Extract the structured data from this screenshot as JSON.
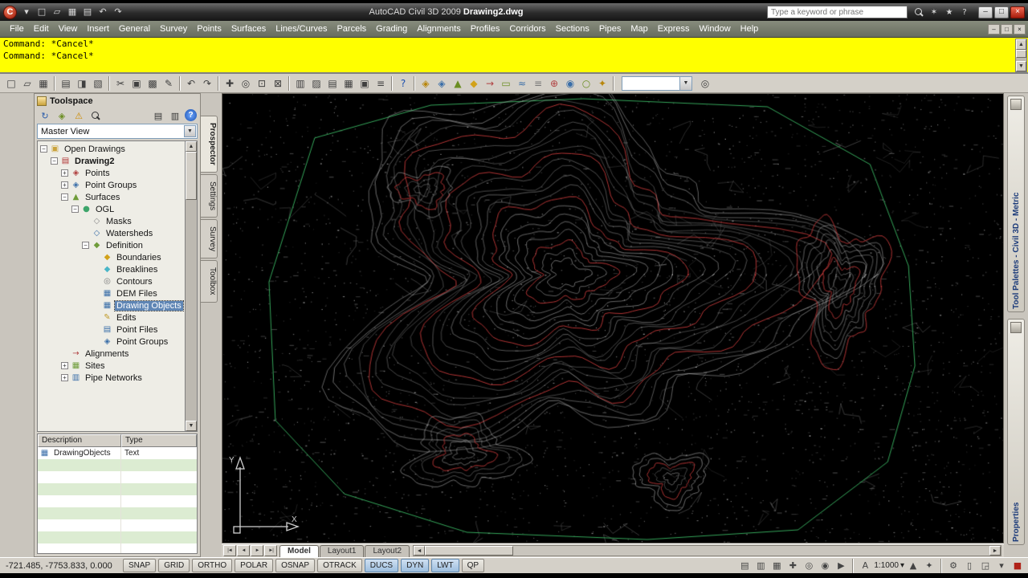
{
  "window": {
    "app_title": "AutoCAD Civil 3D 2009",
    "doc_title": "Drawing2.dwg",
    "search_placeholder": "Type a keyword or phrase",
    "controls": {
      "minimize": "–",
      "maximize": "□",
      "close": "×"
    },
    "doc_controls": [
      "–",
      "□",
      "×"
    ]
  },
  "titlebar": {
    "icons": [
      {
        "n": "menu-browser",
        "g": "▾"
      },
      {
        "n": "qnew",
        "g": "□"
      },
      {
        "n": "open",
        "g": "▱"
      },
      {
        "n": "save",
        "g": "▦"
      },
      {
        "n": "plot",
        "g": "▤"
      },
      {
        "n": "undo",
        "g": "↶"
      },
      {
        "n": "redo",
        "g": "↷"
      }
    ],
    "infocenter_icons": [
      {
        "n": "search-go",
        "mag": true
      },
      {
        "n": "communication-center",
        "g": "✶"
      },
      {
        "n": "favorites-star",
        "g": "★"
      },
      {
        "n": "infocenter-help",
        "g": "?"
      }
    ]
  },
  "menus": [
    "File",
    "Edit",
    "View",
    "Insert",
    "General",
    "Survey",
    "Points",
    "Surfaces",
    "Lines/Curves",
    "Parcels",
    "Grading",
    "Alignments",
    "Profiles",
    "Corridors",
    "Sections",
    "Pipes",
    "Map",
    "Express",
    "Window",
    "Help"
  ],
  "command": {
    "lines": [
      "Command: *Cancel*",
      "Command: *Cancel*"
    ]
  },
  "toolbar": {
    "items": [
      {
        "n": "qnew",
        "g": "□"
      },
      {
        "n": "open",
        "g": "▱"
      },
      {
        "n": "save",
        "g": "▦"
      },
      "|",
      {
        "n": "plot",
        "g": "▤"
      },
      {
        "n": "plot-preview",
        "g": "◨"
      },
      {
        "n": "publish",
        "g": "▧"
      },
      "|",
      {
        "n": "cut",
        "g": "✂"
      },
      {
        "n": "copy",
        "g": "▣"
      },
      {
        "n": "paste",
        "g": "▩"
      },
      {
        "n": "match-properties",
        "g": "✎"
      },
      "|",
      {
        "n": "undo",
        "g": "↶"
      },
      {
        "n": "redo",
        "g": "↷"
      },
      "|",
      {
        "n": "pan",
        "g": "✚"
      },
      {
        "n": "zoom-realtime",
        "g": "◎"
      },
      {
        "n": "zoom-window",
        "g": "⊡"
      },
      {
        "n": "zoom-previous",
        "g": "⊠"
      },
      "|",
      {
        "n": "properties-window",
        "g": "▥"
      },
      {
        "n": "designcenter",
        "g": "▨"
      },
      {
        "n": "tool-palettes-window",
        "g": "▤"
      },
      {
        "n": "sheet-set-manager",
        "g": "▦"
      },
      {
        "n": "markup-set-manager",
        "g": "▣"
      },
      {
        "n": "quickcalc",
        "g": "≡"
      },
      "|",
      {
        "n": "help",
        "g": "?",
        "c": "#1a4fae"
      },
      "|",
      {
        "n": "import-points",
        "g": "◈",
        "c": "#b8860b"
      },
      {
        "n": "point-groups-tool",
        "g": "◈",
        "c": "#3a6ea8"
      },
      {
        "n": "create-surface",
        "g": "▲",
        "c": "#6b8e23"
      },
      {
        "n": "surface-boundary",
        "g": "◆",
        "c": "#d2a21a"
      },
      {
        "n": "create-alignment",
        "g": "→",
        "c": "#b04040"
      },
      {
        "n": "create-parcel",
        "g": "▭",
        "c": "#6b8e23"
      },
      {
        "n": "create-profile",
        "g": "≈",
        "c": "#3a6ea8"
      },
      {
        "n": "create-corridor",
        "g": "≡",
        "c": "#777777"
      },
      {
        "n": "create-pipe-network",
        "g": "⊕",
        "c": "#b04040"
      },
      {
        "n": "create-grading",
        "g": "◉",
        "c": "#3a6ea8"
      },
      {
        "n": "create-site",
        "g": "○",
        "c": "#6b8e23"
      },
      {
        "n": "labels-menu",
        "g": "✦",
        "c": "#b8860b"
      },
      "|",
      {
        "combo": true
      },
      {
        "n": "named-views",
        "g": "◎"
      }
    ]
  },
  "toolspace": {
    "title": "Toolspace",
    "view_selector": "Master View",
    "tools_left": [
      {
        "n": "refresh",
        "g": "↻",
        "c": "#2a5caa"
      },
      {
        "n": "item-view",
        "g": "◈",
        "c": "#6b8e23"
      },
      {
        "n": "event-viewer",
        "g": "⚠",
        "c": "#cc8a00"
      },
      {
        "n": "search",
        "mag": true
      }
    ],
    "tools_right": [
      {
        "n": "preview-pane",
        "g": "▤"
      },
      {
        "n": "panorama",
        "g": "▥"
      },
      {
        "n": "toolspace-help",
        "help": true
      }
    ],
    "tabs": [
      {
        "label": "Prospector",
        "active": true
      },
      {
        "label": "Settings"
      },
      {
        "label": "Survey"
      },
      {
        "label": "Toolbox"
      }
    ],
    "tree": [
      {
        "label": "Open Drawings",
        "level": 0,
        "exp": "−",
        "glyph": "▣",
        "color": "#caa23a",
        "name": "open-drawings"
      },
      {
        "label": "Drawing2",
        "level": 1,
        "exp": "−",
        "glyph": "▤",
        "color": "#b03434",
        "bold": true,
        "name": "drawing2"
      },
      {
        "label": "Points",
        "level": 2,
        "exp": "+",
        "glyph": "◈",
        "color": "#b04040",
        "name": "points"
      },
      {
        "label": "Point Groups",
        "level": 2,
        "exp": "+",
        "glyph": "◈",
        "color": "#3a6ea8",
        "name": "point-groups"
      },
      {
        "label": "Surfaces",
        "level": 2,
        "exp": "−",
        "glyph": "▲",
        "color": "#6f9c3a",
        "name": "surfaces"
      },
      {
        "label": "OGL",
        "level": 3,
        "exp": "−",
        "glyph": "●",
        "color": "#3da56a",
        "name": "surface-ogl"
      },
      {
        "label": "Masks",
        "level": 4,
        "exp": "",
        "glyph": "◇",
        "color": "#8a8a8a",
        "name": "masks"
      },
      {
        "label": "Watersheds",
        "level": 4,
        "exp": "",
        "glyph": "◇",
        "color": "#3a6ea8",
        "name": "watersheds"
      },
      {
        "label": "Definition",
        "level": 4,
        "exp": "−",
        "glyph": "◆",
        "color": "#6f9c3a",
        "name": "definition"
      },
      {
        "label": "Boundaries",
        "level": 5,
        "exp": "",
        "glyph": "◆",
        "color": "#d2a21a",
        "name": "boundaries"
      },
      {
        "label": "Breaklines",
        "level": 5,
        "exp": "",
        "glyph": "◆",
        "color": "#49b6c8",
        "name": "breaklines"
      },
      {
        "label": "Contours",
        "level": 5,
        "exp": "",
        "glyph": "◎",
        "color": "#7a7a7a",
        "name": "contours"
      },
      {
        "label": "DEM Files",
        "level": 5,
        "exp": "",
        "glyph": "▦",
        "color": "#3a6ea8",
        "name": "dem-files"
      },
      {
        "label": "Drawing Objects",
        "level": 5,
        "exp": "",
        "glyph": "▦",
        "color": "#3a6ea8",
        "selected": true,
        "name": "drawing-objects"
      },
      {
        "label": "Edits",
        "level": 5,
        "exp": "",
        "glyph": "✎",
        "color": "#c09a28",
        "name": "edits"
      },
      {
        "label": "Point Files",
        "level": 5,
        "exp": "",
        "glyph": "▤",
        "color": "#3a6ea8",
        "name": "point-files"
      },
      {
        "label": "Point Groups",
        "level": 5,
        "exp": "",
        "glyph": "◈",
        "color": "#3a6ea8",
        "name": "definition-point-groups"
      },
      {
        "label": "Alignments",
        "level": 2,
        "exp": "",
        "glyph": "→",
        "color": "#b04040",
        "name": "alignments"
      },
      {
        "label": "Sites",
        "level": 2,
        "exp": "+",
        "glyph": "▦",
        "color": "#6f9c3a",
        "name": "sites"
      },
      {
        "label": "Pipe Networks",
        "level": 2,
        "exp": "+",
        "glyph": "▥",
        "color": "#3a6ea8",
        "name": "pipe-networks"
      }
    ],
    "table": {
      "headers": [
        "Description",
        "Type"
      ],
      "rows": [
        {
          "icon": "▦",
          "label": "DrawingObjects",
          "type": "Text"
        }
      ]
    }
  },
  "right_tabs": [
    "Tool Palettes - Civil 3D - Metric",
    "Properties"
  ],
  "layout": {
    "nav": [
      "|◄",
      "◄",
      "►",
      "►|"
    ],
    "tabs": [
      {
        "label": "Model",
        "active": true
      },
      {
        "label": "Layout1"
      },
      {
        "label": "Layout2"
      }
    ]
  },
  "status": {
    "coords": "-721.485, -7753.833, 0.000",
    "scale": "1:1000",
    "toggles": [
      {
        "label": "SNAP",
        "active": false
      },
      {
        "label": "GRID",
        "active": false
      },
      {
        "label": "ORTHO",
        "active": false
      },
      {
        "label": "POLAR",
        "active": false
      },
      {
        "label": "OSNAP",
        "active": false
      },
      {
        "label": "OTRACK",
        "active": false
      },
      {
        "label": "DUCS",
        "active": true
      },
      {
        "label": "DYN",
        "active": true
      },
      {
        "label": "LWT",
        "active": true
      },
      {
        "label": "QP",
        "active": false
      }
    ],
    "icons": [
      {
        "n": "model-paper-toggle",
        "g": "▤"
      },
      {
        "n": "quick-view-layouts",
        "g": "▥"
      },
      {
        "n": "quick-view-drawings",
        "g": "▦"
      },
      {
        "n": "pan-status",
        "g": "✚"
      },
      {
        "n": "zoom-status",
        "g": "◎"
      },
      {
        "n": "steering-wheel",
        "g": "◉"
      },
      {
        "n": "show-motion",
        "g": "▶"
      },
      {
        "sep": true
      },
      {
        "scale": true
      },
      {
        "n": "annotation-visibility",
        "g": "▲"
      },
      {
        "n": "annotation-autoscale",
        "g": "✦"
      },
      {
        "sep": true
      },
      {
        "n": "workspace-switching",
        "g": "⚙"
      },
      {
        "n": "toolbar-lock",
        "g": "▯"
      },
      {
        "n": "clean-screen",
        "g": "◲"
      },
      {
        "n": "status-menu",
        "g": "▾"
      },
      {
        "n": "status-alert",
        "g": "■",
        "red": true
      }
    ]
  }
}
